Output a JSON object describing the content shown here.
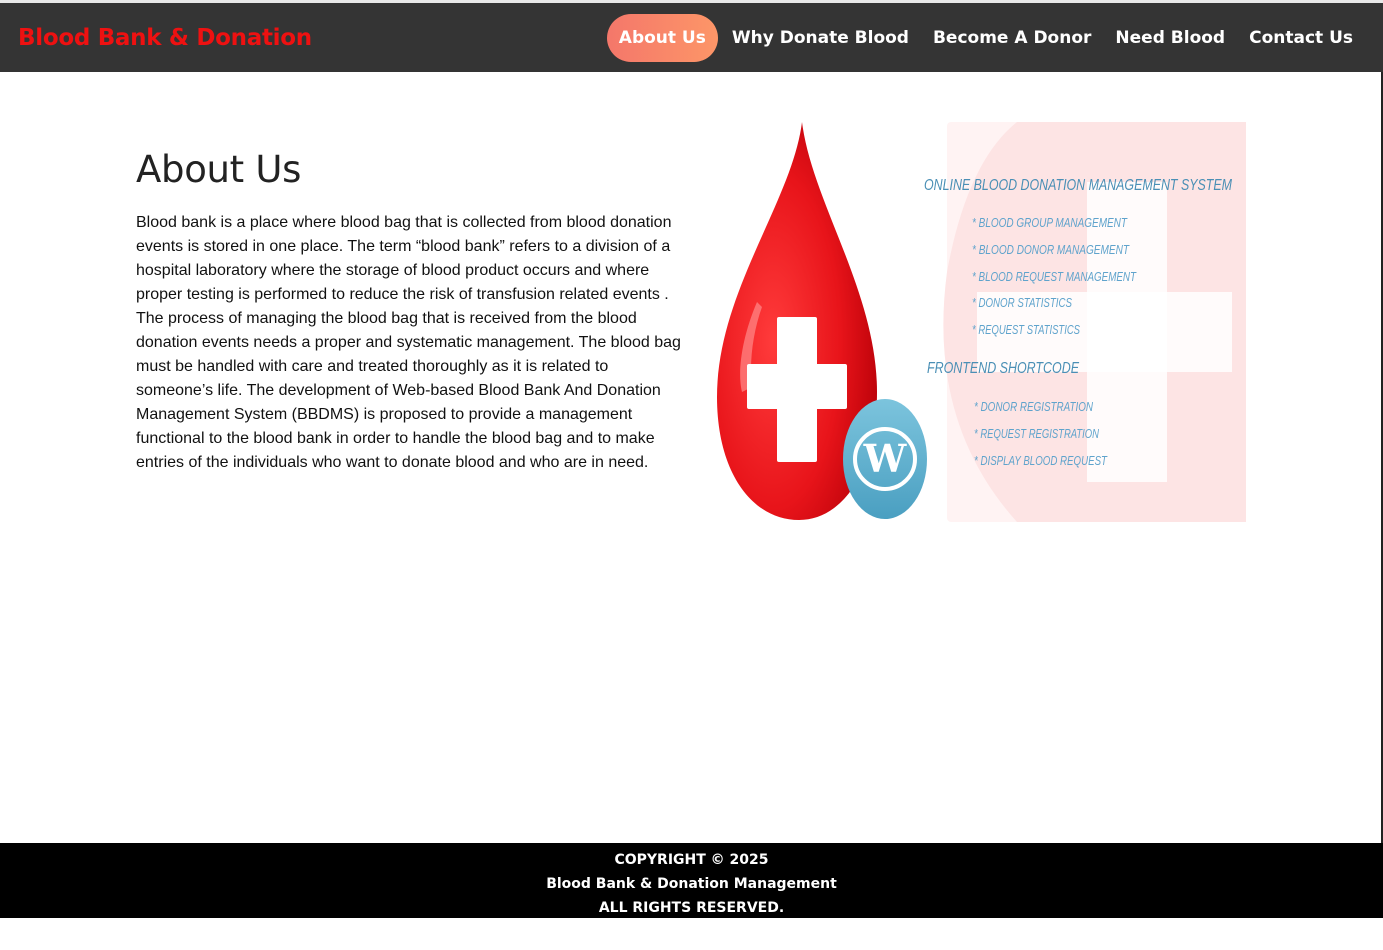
{
  "brand": {
    "title": "Blood Bank & Donation"
  },
  "nav": {
    "items": [
      {
        "label": "About Us",
        "active": true
      },
      {
        "label": "Why Donate Blood"
      },
      {
        "label": "Become A Donor"
      },
      {
        "label": "Need Blood"
      },
      {
        "label": "Contact Us"
      }
    ]
  },
  "main": {
    "title": "About Us",
    "body": "Blood bank is a place where blood bag that is collected from blood donation events is stored in one place. The term “blood bank” refers to a division of a hospital laboratory where the storage of blood product occurs and where proper testing is performed to reduce the risk of transfusion related events . The process of managing the blood bag that is received from the blood donation events needs a proper and systematic management. The blood bag must be handled with care and treated thoroughly as it is related to someone’s life. The development of Web-based Blood Bank And Donation Management System (BBDMS) is proposed to provide a management functional to the blood bank in order to handle the blood bag and to make entries of the individuals who want to donate blood and who are in need."
  },
  "hero": {
    "heading": "ONLINE BLOOD DONATION MANAGEMENT SYSTEM",
    "features": [
      "* BLOOD GROUP MANAGEMENT",
      "* BLOOD DONOR MANAGEMENT",
      "* BLOOD REQUEST MANAGEMENT",
      "* DONOR STATISTICS",
      "* REQUEST STATISTICS"
    ],
    "subheading": "FRONTEND  SHORTCODE",
    "shortcodes": [
      "* DONOR REGISTRATION",
      "* REQUEST REGISTRATION",
      "* DISPLAY BLOOD REQUEST"
    ],
    "colors": {
      "drop": "#e8141a",
      "text": "#4a8fb5",
      "wp": "#5fb3d1"
    }
  },
  "footer": {
    "line1": "COPYRIGHT © 2025",
    "line2": "Blood Bank & Donation Management",
    "line3": "ALL RIGHTS RESERVED."
  }
}
